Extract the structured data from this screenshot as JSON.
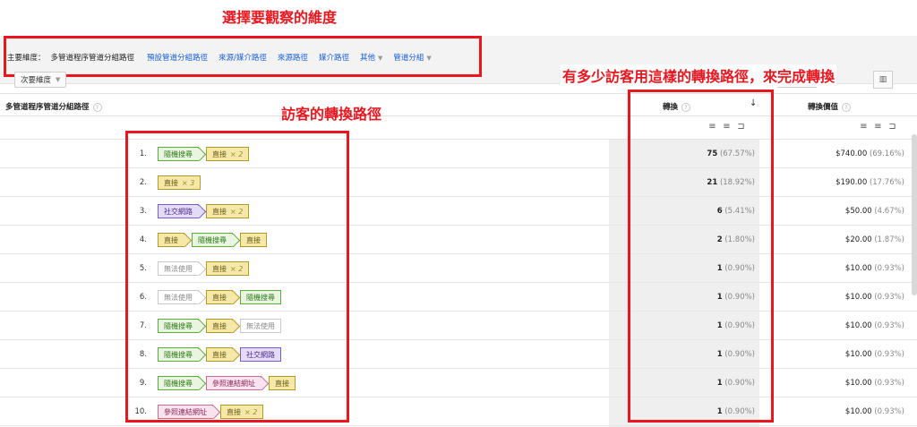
{
  "annotations": {
    "dimension_note": "選擇要觀察的維度",
    "path_note": "訪客的轉換路徑",
    "conversion_note": "有多少訪客用這樣的轉換路徑，來完成轉換"
  },
  "toolbar": {
    "primary_label": "主要維度：",
    "active_dimension": "多管道程序管道分組路徑",
    "links": [
      "預設管道分組路徑",
      "來源/媒介路徑",
      "來源路徑",
      "媒介路徑",
      "其他",
      "管道分組"
    ],
    "secondary_dimension": "次要維度"
  },
  "table": {
    "col_path": "多管道程序管道分組路徑",
    "col_conversions": "轉換",
    "col_value": "轉換價值",
    "help_glyph": "?",
    "sort_glyph": "↓",
    "rows": [
      {
        "num": "1.",
        "conv": "75",
        "conv_pct": "(67.57%)",
        "value": "$740.00",
        "value_pct": "(69.16%)"
      },
      {
        "num": "2.",
        "conv": "21",
        "conv_pct": "(18.92%)",
        "value": "$190.00",
        "value_pct": "(17.76%)"
      },
      {
        "num": "3.",
        "conv": "6",
        "conv_pct": "(5.41%)",
        "value": "$50.00",
        "value_pct": "(4.67%)"
      },
      {
        "num": "4.",
        "conv": "2",
        "conv_pct": "(1.80%)",
        "value": "$20.00",
        "value_pct": "(1.87%)"
      },
      {
        "num": "5.",
        "conv": "1",
        "conv_pct": "(0.90%)",
        "value": "$10.00",
        "value_pct": "(0.93%)"
      },
      {
        "num": "6.",
        "conv": "1",
        "conv_pct": "(0.90%)",
        "value": "$10.00",
        "value_pct": "(0.93%)"
      },
      {
        "num": "7.",
        "conv": "1",
        "conv_pct": "(0.90%)",
        "value": "$10.00",
        "value_pct": "(0.93%)"
      },
      {
        "num": "8.",
        "conv": "1",
        "conv_pct": "(0.90%)",
        "value": "$10.00",
        "value_pct": "(0.93%)"
      },
      {
        "num": "9.",
        "conv": "1",
        "conv_pct": "(0.90%)",
        "value": "$10.00",
        "value_pct": "(0.93%)"
      },
      {
        "num": "10.",
        "conv": "1",
        "conv_pct": "(0.90%)",
        "value": "$10.00",
        "value_pct": "(0.93%)"
      }
    ]
  },
  "channels": {
    "organic": "隨機搜尋",
    "direct": "直接",
    "social": "社交網路",
    "unavailable": "無法使用",
    "referral": "參照連結網址",
    "x2": "× 2",
    "x3": "× 3"
  },
  "colors": {
    "annotation_red": "#e8171f",
    "link_blue": "#1a5fd8",
    "organic": "#5cab3a",
    "direct": "#b29a2b",
    "social": "#7d5cc4",
    "referral": "#c2708f"
  }
}
